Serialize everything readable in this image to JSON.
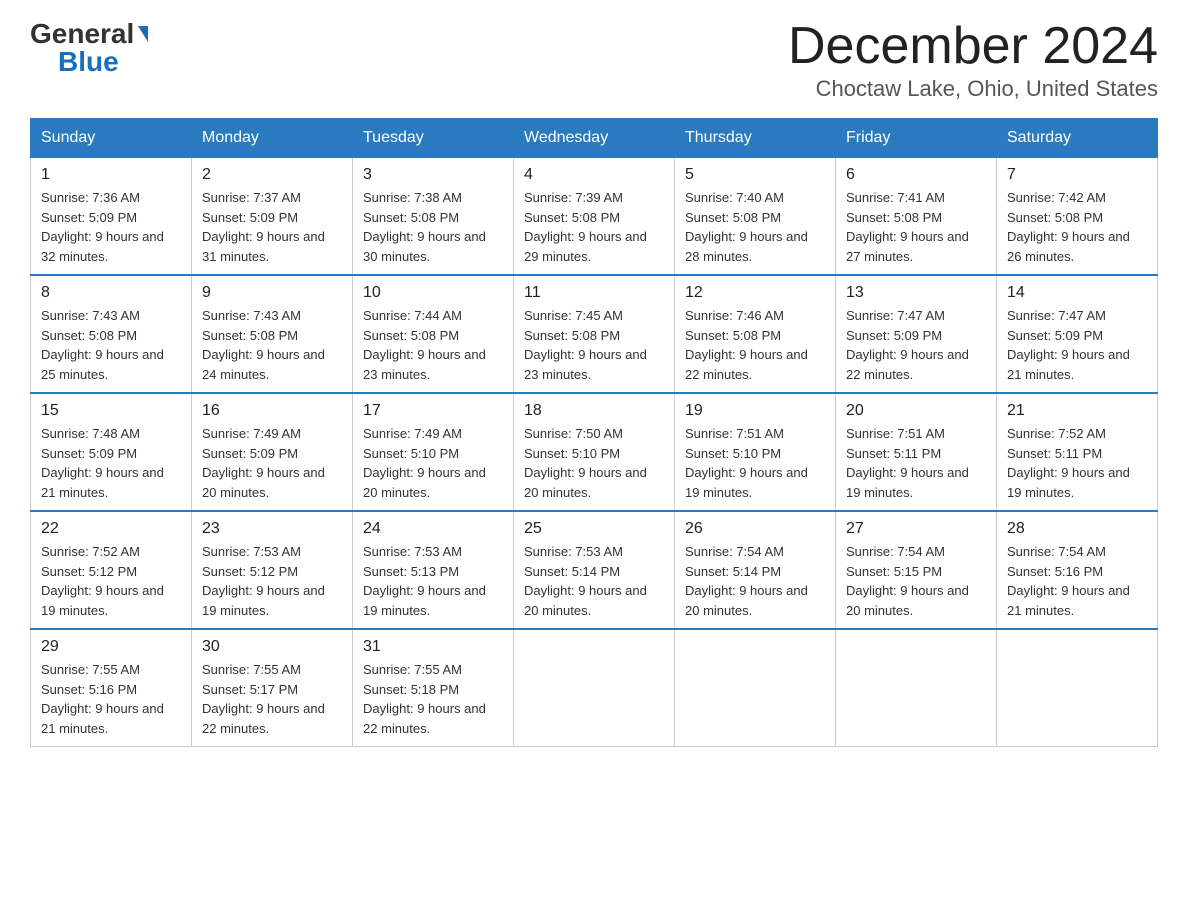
{
  "header": {
    "logo_general": "General",
    "logo_blue": "Blue",
    "month_title": "December 2024",
    "location": "Choctaw Lake, Ohio, United States"
  },
  "weekdays": [
    "Sunday",
    "Monday",
    "Tuesday",
    "Wednesday",
    "Thursday",
    "Friday",
    "Saturday"
  ],
  "weeks": [
    [
      {
        "day": "1",
        "sunrise": "7:36 AM",
        "sunset": "5:09 PM",
        "daylight": "9 hours and 32 minutes."
      },
      {
        "day": "2",
        "sunrise": "7:37 AM",
        "sunset": "5:09 PM",
        "daylight": "9 hours and 31 minutes."
      },
      {
        "day": "3",
        "sunrise": "7:38 AM",
        "sunset": "5:08 PM",
        "daylight": "9 hours and 30 minutes."
      },
      {
        "day": "4",
        "sunrise": "7:39 AM",
        "sunset": "5:08 PM",
        "daylight": "9 hours and 29 minutes."
      },
      {
        "day": "5",
        "sunrise": "7:40 AM",
        "sunset": "5:08 PM",
        "daylight": "9 hours and 28 minutes."
      },
      {
        "day": "6",
        "sunrise": "7:41 AM",
        "sunset": "5:08 PM",
        "daylight": "9 hours and 27 minutes."
      },
      {
        "day": "7",
        "sunrise": "7:42 AM",
        "sunset": "5:08 PM",
        "daylight": "9 hours and 26 minutes."
      }
    ],
    [
      {
        "day": "8",
        "sunrise": "7:43 AM",
        "sunset": "5:08 PM",
        "daylight": "9 hours and 25 minutes."
      },
      {
        "day": "9",
        "sunrise": "7:43 AM",
        "sunset": "5:08 PM",
        "daylight": "9 hours and 24 minutes."
      },
      {
        "day": "10",
        "sunrise": "7:44 AM",
        "sunset": "5:08 PM",
        "daylight": "9 hours and 23 minutes."
      },
      {
        "day": "11",
        "sunrise": "7:45 AM",
        "sunset": "5:08 PM",
        "daylight": "9 hours and 23 minutes."
      },
      {
        "day": "12",
        "sunrise": "7:46 AM",
        "sunset": "5:08 PM",
        "daylight": "9 hours and 22 minutes."
      },
      {
        "day": "13",
        "sunrise": "7:47 AM",
        "sunset": "5:09 PM",
        "daylight": "9 hours and 22 minutes."
      },
      {
        "day": "14",
        "sunrise": "7:47 AM",
        "sunset": "5:09 PM",
        "daylight": "9 hours and 21 minutes."
      }
    ],
    [
      {
        "day": "15",
        "sunrise": "7:48 AM",
        "sunset": "5:09 PM",
        "daylight": "9 hours and 21 minutes."
      },
      {
        "day": "16",
        "sunrise": "7:49 AM",
        "sunset": "5:09 PM",
        "daylight": "9 hours and 20 minutes."
      },
      {
        "day": "17",
        "sunrise": "7:49 AM",
        "sunset": "5:10 PM",
        "daylight": "9 hours and 20 minutes."
      },
      {
        "day": "18",
        "sunrise": "7:50 AM",
        "sunset": "5:10 PM",
        "daylight": "9 hours and 20 minutes."
      },
      {
        "day": "19",
        "sunrise": "7:51 AM",
        "sunset": "5:10 PM",
        "daylight": "9 hours and 19 minutes."
      },
      {
        "day": "20",
        "sunrise": "7:51 AM",
        "sunset": "5:11 PM",
        "daylight": "9 hours and 19 minutes."
      },
      {
        "day": "21",
        "sunrise": "7:52 AM",
        "sunset": "5:11 PM",
        "daylight": "9 hours and 19 minutes."
      }
    ],
    [
      {
        "day": "22",
        "sunrise": "7:52 AM",
        "sunset": "5:12 PM",
        "daylight": "9 hours and 19 minutes."
      },
      {
        "day": "23",
        "sunrise": "7:53 AM",
        "sunset": "5:12 PM",
        "daylight": "9 hours and 19 minutes."
      },
      {
        "day": "24",
        "sunrise": "7:53 AM",
        "sunset": "5:13 PM",
        "daylight": "9 hours and 19 minutes."
      },
      {
        "day": "25",
        "sunrise": "7:53 AM",
        "sunset": "5:14 PM",
        "daylight": "9 hours and 20 minutes."
      },
      {
        "day": "26",
        "sunrise": "7:54 AM",
        "sunset": "5:14 PM",
        "daylight": "9 hours and 20 minutes."
      },
      {
        "day": "27",
        "sunrise": "7:54 AM",
        "sunset": "5:15 PM",
        "daylight": "9 hours and 20 minutes."
      },
      {
        "day": "28",
        "sunrise": "7:54 AM",
        "sunset": "5:16 PM",
        "daylight": "9 hours and 21 minutes."
      }
    ],
    [
      {
        "day": "29",
        "sunrise": "7:55 AM",
        "sunset": "5:16 PM",
        "daylight": "9 hours and 21 minutes."
      },
      {
        "day": "30",
        "sunrise": "7:55 AM",
        "sunset": "5:17 PM",
        "daylight": "9 hours and 22 minutes."
      },
      {
        "day": "31",
        "sunrise": "7:55 AM",
        "sunset": "5:18 PM",
        "daylight": "9 hours and 22 minutes."
      },
      null,
      null,
      null,
      null
    ]
  ]
}
